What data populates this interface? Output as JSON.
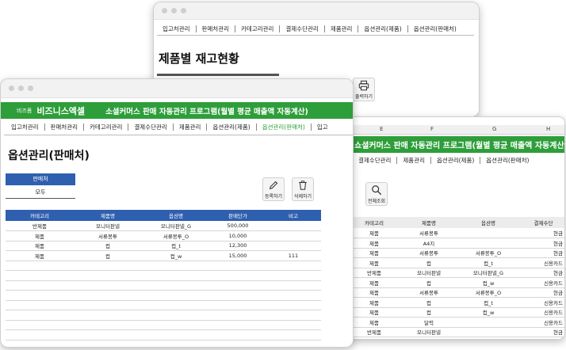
{
  "colors": {
    "accent_green": "#2e9e3a",
    "header_blue": "#2f5faf",
    "grid_gray": "#d6d6d6"
  },
  "win_back": {
    "menu": [
      "입고처관리",
      "판매처관리",
      "카테고리관리",
      "결제수단관리",
      "제품관리",
      "옵션관리(제품)",
      "옵션관리(판매처)"
    ],
    "title": "제품별 재고현황",
    "print_label": "출력하기"
  },
  "win_right": {
    "col_letters": [
      "E",
      "F",
      "G",
      "H"
    ],
    "banner": "쇼셜커머스 판매 자동관리 프로그램(월별 평균 매출액 자동계산)",
    "menu": [
      "결제수단관리",
      "제품관리",
      "옵션관리(제품)",
      "옵션관리(판매처)"
    ],
    "search_label": "전체조회",
    "headers": [
      "카테고리",
      "제품명",
      "옵션명",
      "결제수단"
    ],
    "rows": [
      [
        "제품",
        "서류봉투",
        "",
        "현금"
      ],
      [
        "제품",
        "A4지",
        "",
        "현금"
      ],
      [
        "제품",
        "서류봉투",
        "서류봉투_O",
        "현금"
      ],
      [
        "제품",
        "컵",
        "컵_t",
        "신용카드"
      ],
      [
        "반제품",
        "모니터판넬",
        "모니터판넬_G",
        "현금"
      ],
      [
        "제품",
        "컵",
        "컵_w",
        "신용카드"
      ],
      [
        "제품",
        "서류봉투",
        "서류봉투_O",
        "현금"
      ],
      [
        "제품",
        "컵",
        "컵_t",
        "신용카드"
      ],
      [
        "제품",
        "컵",
        "컵_w",
        "신용카드"
      ],
      [
        "제품",
        "달력",
        "",
        "신용카드"
      ],
      [
        "반제품",
        "모니터판넬",
        "",
        "현금"
      ]
    ]
  },
  "win_front": {
    "logo_small": "비즈폼",
    "logo_big": "비즈니스엑셀",
    "banner": "소셜커머스 판매 자동관리 프로그램(월별 평균 매출액 자동계산)",
    "menu": [
      "입고처관리",
      "판매처관리",
      "카테고리관리",
      "결제수단관리",
      "제품관리",
      "옵션관리(제품)",
      "옵션관리(판매처)",
      "입고"
    ],
    "page_title": "옵션관리(판매처)",
    "filter_label": "판매처",
    "filter_value": "모두",
    "register_label": "등록하기",
    "delete_label": "삭제하기",
    "headers": [
      "카테고리",
      "제품명",
      "옵션명",
      "판매단가",
      "비고"
    ],
    "rows": [
      [
        "반제품",
        "모니터판넬",
        "모니터판넬_G",
        "500,000",
        ""
      ],
      [
        "제품",
        "서류봉투",
        "서류봉투_O",
        "10,000",
        ""
      ],
      [
        "제품",
        "컵",
        "컵_t",
        "12,300",
        ""
      ],
      [
        "제품",
        "컵",
        "컵_w",
        "15,000",
        "111"
      ]
    ],
    "empty_rows": 9
  }
}
